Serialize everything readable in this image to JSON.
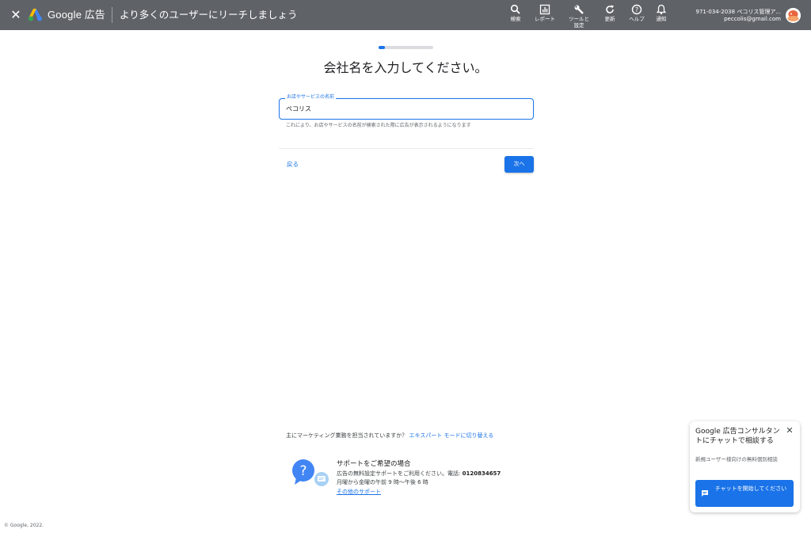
{
  "header": {
    "close_icon": "close-icon",
    "brand_google": "Google",
    "brand_product": "広告",
    "title": "より多くのユーザーにリーチしましょう",
    "tools": [
      {
        "icon": "search-icon",
        "label": "検索"
      },
      {
        "icon": "report-icon",
        "label": "レポート"
      },
      {
        "icon": "wrench-icon",
        "label": "ツールと\n設定"
      },
      {
        "icon": "refresh-icon",
        "label": "更新"
      },
      {
        "icon": "help-icon",
        "label": "ヘルプ"
      },
      {
        "icon": "bell-icon",
        "label": "通知"
      }
    ],
    "account_line1": "971-034-2038 ペコリス管理ア...",
    "account_email": "peccolis@gmail.com"
  },
  "progress": {
    "value": 0.12
  },
  "main": {
    "heading": "会社名を入力してください。",
    "field_label": "お店やサービスの名前",
    "field_value": "ペコリス",
    "helper": "これにより、お店やサービスの名前が検索された際に広告が表示されるようになります",
    "back_label": "戻る",
    "next_label": "次へ"
  },
  "expert": {
    "question": "主にマーケティング業務を担当されていますか？",
    "link": "エキスパート モードに切り替える"
  },
  "support": {
    "title": "サポートをご希望の場合",
    "text": "広告の無料設定サポートをご利用ください。電話: ",
    "phone": "0120834657",
    "hours": "月曜から金曜の午前 9 時〜午後 6 時",
    "more_link": "その他のサポート"
  },
  "chat": {
    "title": "Google 広告コンサルタントにチャットで相談する",
    "desc": "新規ユーザー様向けの無料個別相談",
    "button": "チャットを開始してください"
  },
  "footer": {
    "copyright": "© Google, 2022."
  },
  "colors": {
    "topbar": "#5f6368",
    "accent": "#1a73e8"
  }
}
